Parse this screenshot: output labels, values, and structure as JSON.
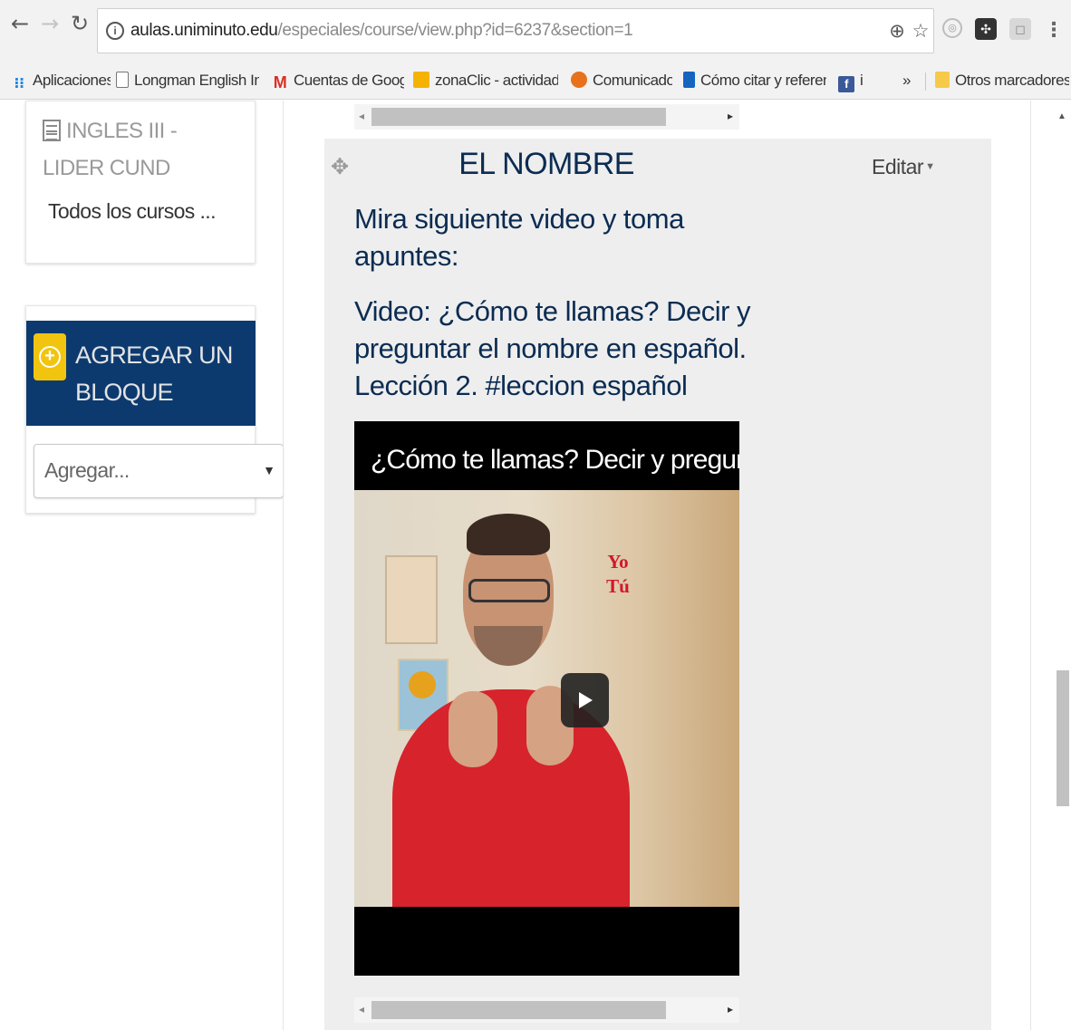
{
  "browser": {
    "url_host": "aulas.uniminuto.edu",
    "url_path": "/especiales/course/view.php?id=6237&section=1"
  },
  "bookmarks": [
    {
      "label": "Aplicaciones",
      "icon": "apps-grid-icon"
    },
    {
      "label": "Longman English Inte",
      "icon": "page-icon"
    },
    {
      "label": "Cuentas de Google",
      "icon": "gmail-icon"
    },
    {
      "label": "zonaClic - actividades",
      "icon": "zonaclic-icon"
    },
    {
      "label": "Comunicados",
      "icon": "comunicados-icon"
    },
    {
      "label": "Cómo citar y referenc",
      "icon": "bookmark-blue-icon"
    },
    {
      "label": "i",
      "icon": "facebook-icon"
    }
  ],
  "bookmarks_overflow": "»",
  "other_bookmarks": "Otros marcadores",
  "sidebar": {
    "course_link": "INGLES III - LIDER CUND",
    "all_courses": "Todos los cursos ...",
    "add_block_title": "AGREGAR UN BLOQUE",
    "add_block_select": "Agregar..."
  },
  "section": {
    "title": "EL NOMBRE",
    "edit_label": "Editar",
    "paragraph1": "Mira siguiente video y toma apuntes:",
    "paragraph2": "Video: ¿Cómo te llamas? Decir y preguntar el nombre en español. Lección 2. #leccion español"
  },
  "video": {
    "title": "¿Cómo te llamas? Decir y preguntar el no",
    "overlay_text_1": "Yo",
    "overlay_text_2": "Tú"
  },
  "colors": {
    "brand_navy": "#0c3a6f",
    "accent_yellow": "#f1c40f",
    "heading_text": "#0b2c52"
  }
}
